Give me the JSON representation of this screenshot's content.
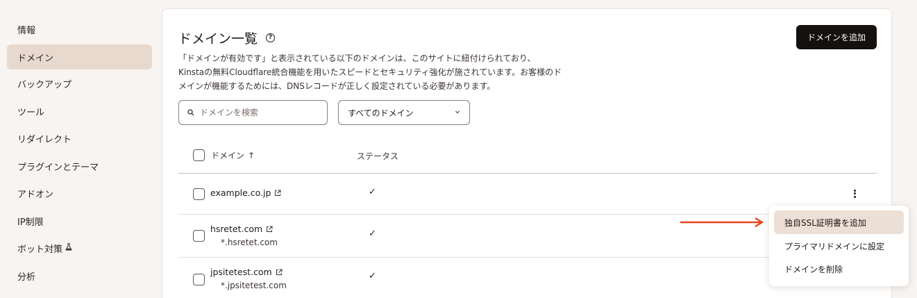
{
  "sidebar": {
    "items": [
      {
        "label": "情報"
      },
      {
        "label": "ドメイン",
        "active": true
      },
      {
        "label": "バックアップ"
      },
      {
        "label": "ツール"
      },
      {
        "label": "リダイレクト"
      },
      {
        "label": "プラグインとテーマ"
      },
      {
        "label": "アドオン"
      },
      {
        "label": "IP制限"
      },
      {
        "label": "ボット対策",
        "icon": "flask-icon"
      },
      {
        "label": "分析"
      }
    ]
  },
  "main": {
    "title": "ドメイン一覧",
    "help_icon": "help-circle-icon",
    "description_lines": [
      "「ドメインが有効です」と表示されている以下のドメインは、このサイトに紐付けられており、",
      "Kinstaの無料Cloudflare統合機能を用いたスピードとセキュリティ強化が施されています。お客様のド",
      "メインが機能するためには、DNSレコードが正しく設定されている必要があります。"
    ],
    "add_button": "ドメインを追加",
    "search": {
      "placeholder": "ドメインを検索",
      "value": "",
      "icon": "search-icon"
    },
    "filter": {
      "selected": "すべてのドメイン",
      "icon": "chevron-down-icon"
    },
    "table": {
      "headers": {
        "domain": "ドメイン",
        "sort": "↑",
        "status": "ステータス"
      },
      "rows": [
        {
          "domain": "example.co.jp",
          "subdomain": "",
          "status": "✓"
        },
        {
          "domain": "hsretet.com",
          "subdomain": "*.hsretet.com",
          "status": "✓"
        },
        {
          "domain": "jpsitetest.com",
          "subdomain": "*.jpsitetest.com",
          "status": "✓"
        }
      ]
    }
  },
  "context_menu": {
    "items": [
      {
        "label": "独自SSL証明書を追加",
        "highlighted": true
      },
      {
        "label": "プライマリドメインに設定"
      },
      {
        "label": "ドメインを削除"
      }
    ]
  },
  "colors": {
    "accent_arrow": "#e8451e",
    "primary_button": "#15110f",
    "active_nav": "#e8d9cf"
  }
}
